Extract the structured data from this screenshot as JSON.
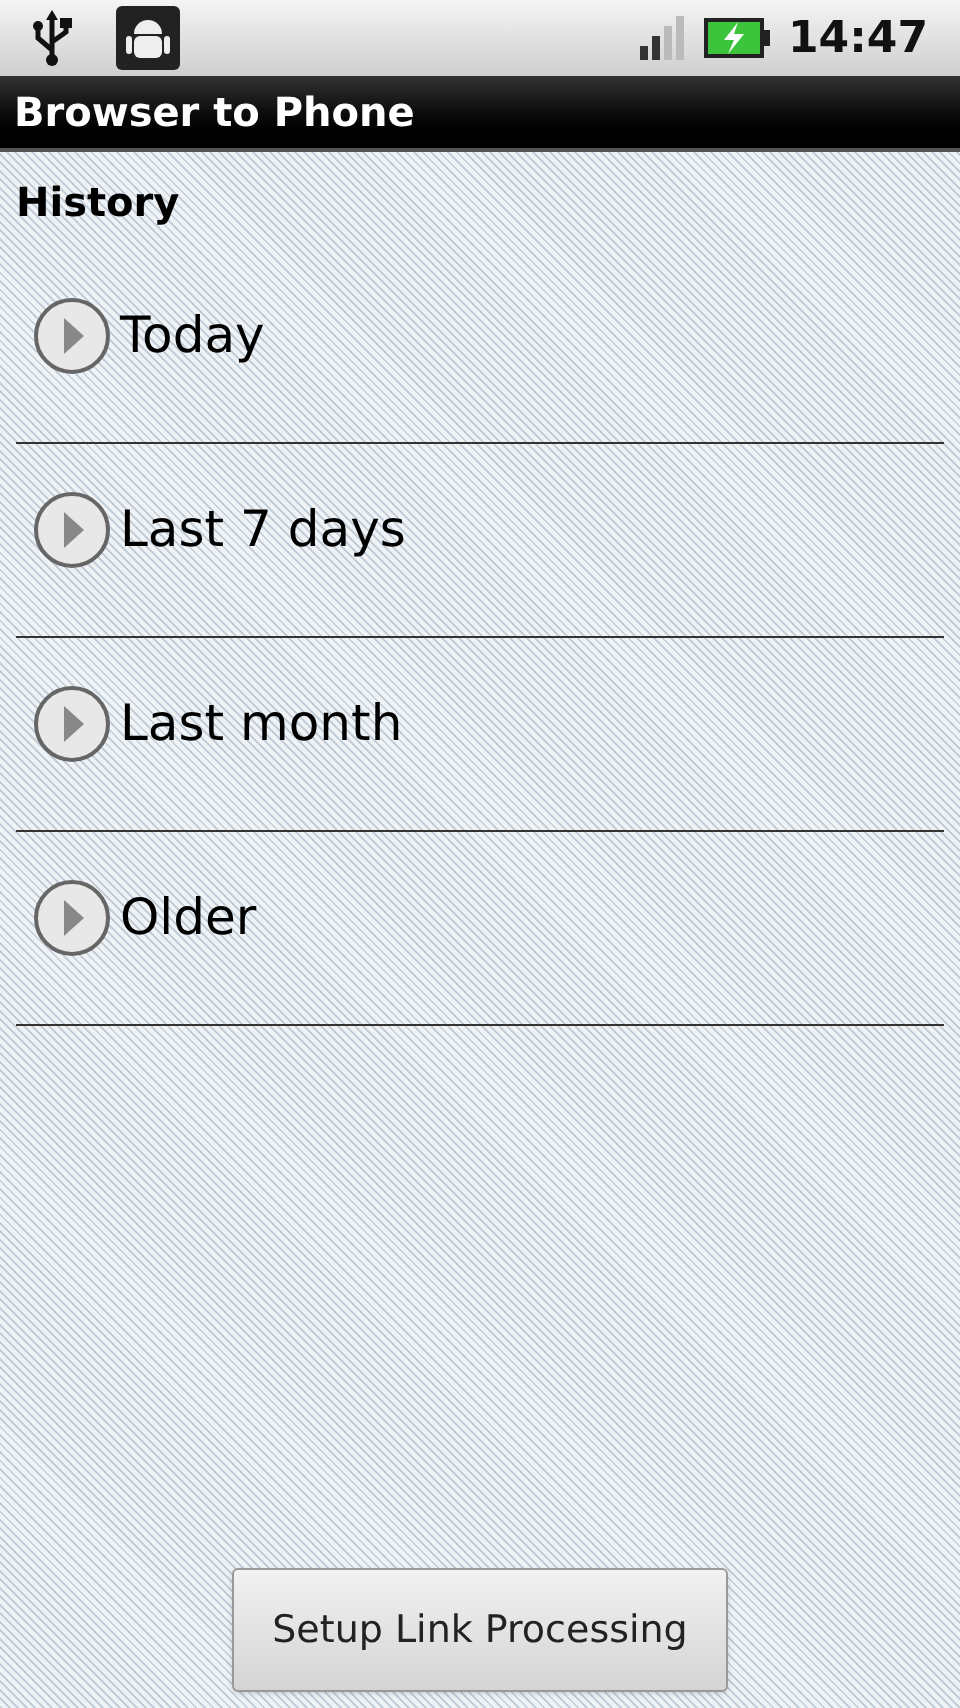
{
  "status_bar": {
    "time": "14:47"
  },
  "window": {
    "title": "Browser to Phone"
  },
  "section": {
    "title": "History"
  },
  "groups": [
    {
      "label": "Today",
      "expanded": false
    },
    {
      "label": "Last 7 days",
      "expanded": false
    },
    {
      "label": "Last month",
      "expanded": false
    },
    {
      "label": "Older",
      "expanded": false
    }
  ],
  "button": {
    "label": "Setup Link Processing"
  }
}
